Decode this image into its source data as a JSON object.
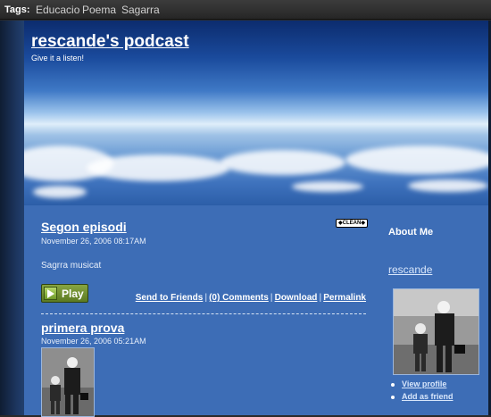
{
  "tagbar": {
    "label": "Tags:",
    "tags": [
      "Educacio",
      "Poema",
      "Sagarra"
    ]
  },
  "header": {
    "title": "rescande's podcast",
    "subtitle": "Give it a listen!"
  },
  "posts": [
    {
      "title": "Segon episodi",
      "date": "November 26, 2006 08:17AM",
      "body": "Sagrra musicat",
      "badge": "◆CLEAN◆",
      "play_label": "Play",
      "links": {
        "send": "Send to Friends",
        "comments": "(0) Comments",
        "download": "Download",
        "permalink": "Permalink"
      }
    },
    {
      "title": "primera prova",
      "date": "November 26, 2006 05:21AM"
    }
  ],
  "sidebar": {
    "heading": "About Me",
    "name": "rescande",
    "links": [
      "View profile",
      "Add as friend"
    ]
  },
  "colors": {
    "content_bg": "#3d6db6",
    "tagbar_bg": "#2e2e2e",
    "play_green": "#6f8f2a"
  }
}
